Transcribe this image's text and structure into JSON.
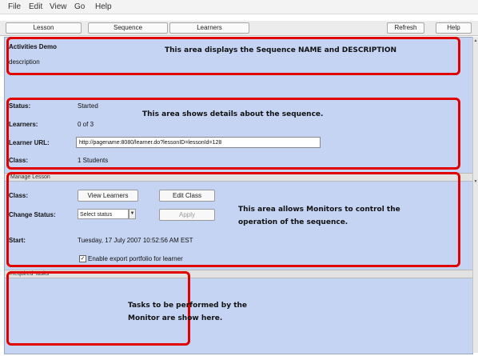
{
  "menu": [
    "File",
    "Edit",
    "View",
    "Go",
    "Help"
  ],
  "tabs": [
    "Lesson",
    "Sequence",
    "Learners"
  ],
  "toolbar": {
    "refresh": "Refresh",
    "help": "Help"
  },
  "activity": {
    "title": "Activities Demo",
    "description": "description"
  },
  "details": {
    "status_label": "Status:",
    "status_value": "Started",
    "learners_label": "Learners:",
    "learners_value": "0 of 3",
    "url_label": "Learner URL:",
    "url_value": "http://pagename:8080/learner.do?lessonID=lessonId=128",
    "class_label": "Class:",
    "class_value": "1 Students"
  },
  "manage": {
    "section_title": "Manage Lesson",
    "class_label": "Class:",
    "view_learners": "View Learners",
    "edit_class": "Edit Class",
    "change_status_label": "Change Status:",
    "select_status": "Select status",
    "apply": "Apply",
    "start_label": "Start:",
    "start_value": "Tuesday, 17 July 2007 10:52:56 AM EST",
    "checkbox_label": "Enable export portfolio for learner"
  },
  "tasks": {
    "section_title": "Required Tasks"
  },
  "annotations": {
    "sequence": "This area displays the Sequence NAME and DESCRIPTION",
    "details": "This area shows details about the sequence.",
    "control_line1": "This area allows Monitors to control the",
    "control_line2": "operation of the sequence.",
    "tasks_line1": "Tasks to be performed by the",
    "tasks_line2": "Monitor are show here."
  },
  "colors": {
    "panel": "#c5d4f3",
    "callout": "#e00000"
  }
}
